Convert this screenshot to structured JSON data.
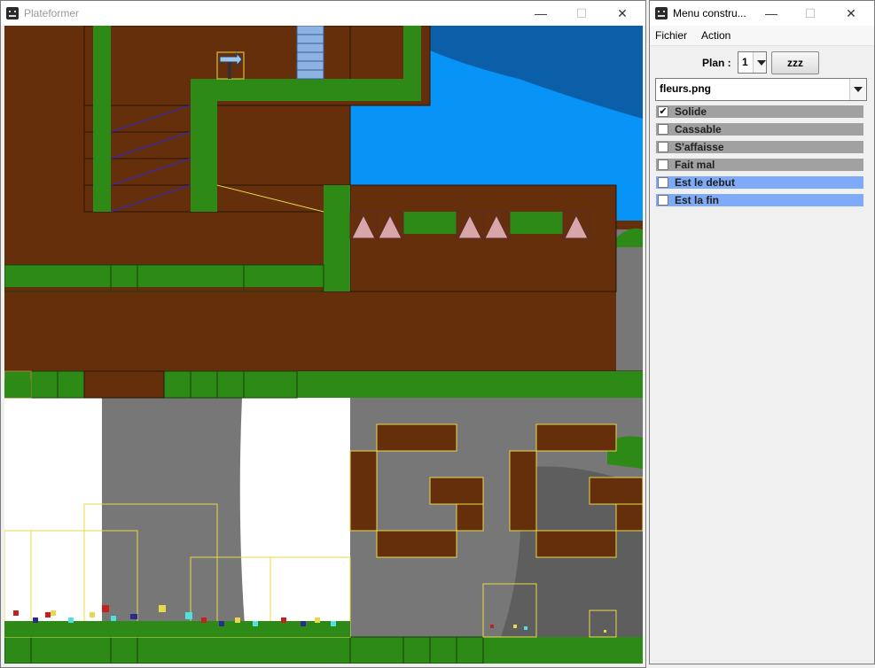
{
  "game_window": {
    "title": "Plateformer",
    "minimize": "—",
    "maximize": "☐",
    "close": "✕"
  },
  "menu_window": {
    "title": "Menu constru...",
    "minimize": "—",
    "maximize": "☐",
    "close": "✕",
    "menus": [
      "Fichier",
      "Action"
    ],
    "plan_label": "Plan :",
    "plan_value": "1",
    "zzz_button": "zzz",
    "tile_file": "fleurs.png",
    "options": [
      {
        "label": "Solide",
        "checked": true,
        "color": "#a1a1a1"
      },
      {
        "label": "Cassable",
        "checked": false,
        "color": "#a1a1a1"
      },
      {
        "label": "S'affaisse",
        "checked": false,
        "color": "#a1a1a1"
      },
      {
        "label": "Fait mal",
        "checked": false,
        "color": "#a1a1a1"
      },
      {
        "label": "Est le debut",
        "checked": false,
        "color": "#7eaaf7"
      },
      {
        "label": "Est la fin",
        "checked": false,
        "color": "#7eaaf7"
      }
    ],
    "check_glyph": "✔"
  },
  "colors": {
    "dirt": "#652f0c",
    "grass": "#2d8a16",
    "sky": "#0794f6",
    "rock": "#777777",
    "ladder": "#8db3e2",
    "spike": "#d8a5a8",
    "selection": "#e8d84a"
  }
}
